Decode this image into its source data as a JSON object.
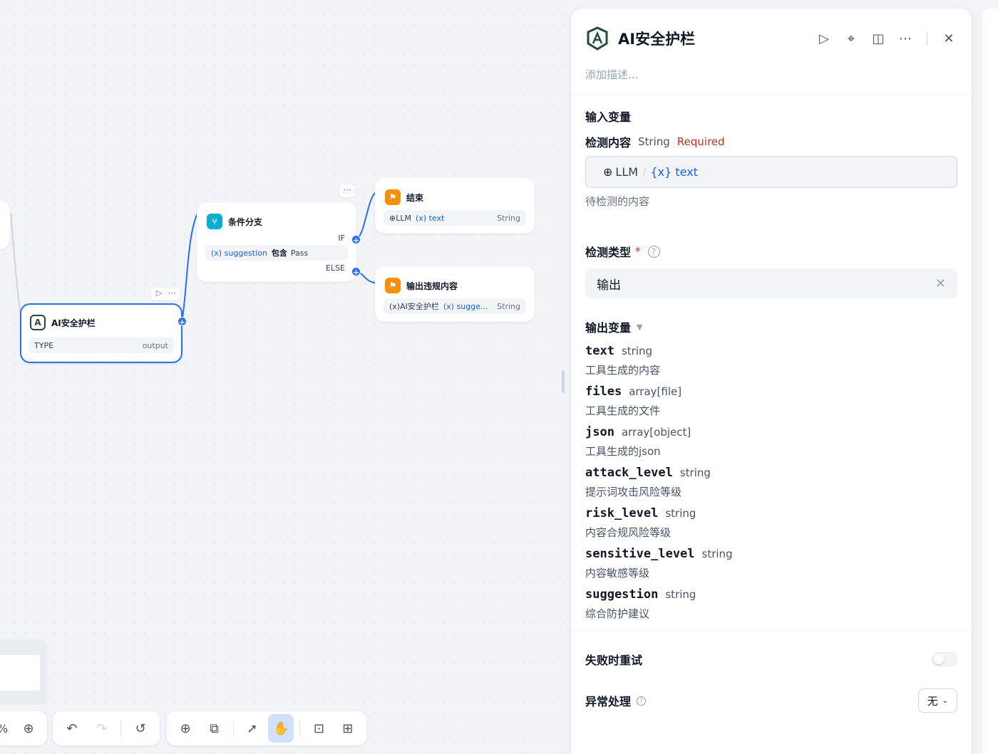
{
  "canvas": {
    "nodes": {
      "guard": {
        "title": "AI安全护栏",
        "var_label": "TYPE",
        "var_value": "output"
      },
      "branch": {
        "title": "条件分支",
        "if_label": "IF",
        "else_label": "ELSE",
        "cond_var": "suggestion",
        "cond_op": "包含",
        "cond_value": "Pass"
      },
      "end": {
        "title": "结束",
        "src": "LLM",
        "var": "text",
        "type": "String"
      },
      "violation": {
        "title": "输出违规内容",
        "src": "AI安全护栏",
        "var": "sugge...",
        "type": "String"
      }
    },
    "zoom_suffix": "%"
  },
  "panel": {
    "title": "AI安全护栏",
    "description_placeholder": "添加描述...",
    "input_section_title": "输入变量",
    "input_field": {
      "name": "检测内容",
      "type": "String",
      "required": "Required",
      "source": "LLM",
      "var": "text",
      "hint": "待检测的内容"
    },
    "detect_type": {
      "label": "检测类型",
      "required_mark": "*",
      "help": "?",
      "value": "输出"
    },
    "output_section_title": "输出变量",
    "outputs": [
      {
        "name": "text",
        "type": "string",
        "desc": "工具生成的内容"
      },
      {
        "name": "files",
        "type": "array[file]",
        "desc": "工具生成的文件"
      },
      {
        "name": "json",
        "type": "array[object]",
        "desc": "工具生成的json"
      },
      {
        "name": "attack_level",
        "type": "string",
        "desc": "提示词攻击风险等级"
      },
      {
        "name": "risk_level",
        "type": "string",
        "desc": "内容合规风险等级"
      },
      {
        "name": "sensitive_level",
        "type": "string",
        "desc": "内容敏感等级"
      },
      {
        "name": "suggestion",
        "type": "string",
        "desc": "综合防护建议"
      }
    ],
    "retry_label": "失败时重试",
    "error_label": "异常处理",
    "error_value": "无"
  },
  "colors": {
    "accent": "#2970ff",
    "logo": "#1f4d3a",
    "orange": "#f79009",
    "cyan": "#06aed4",
    "required": "#d92d20"
  }
}
